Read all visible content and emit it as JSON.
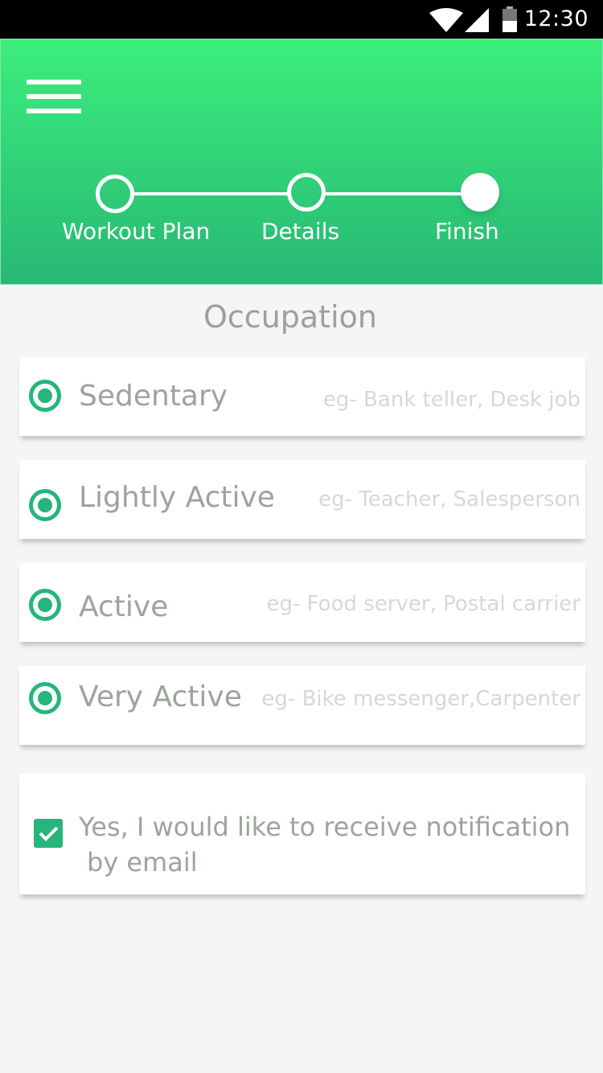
{
  "status_bar": {
    "time": "12:30",
    "icons": [
      "wifi-icon",
      "cellular-signal-icon",
      "battery-icon"
    ]
  },
  "header": {
    "menu_icon": "hamburger-menu-icon",
    "steps": [
      {
        "label": "Workout Plan",
        "state": "completed"
      },
      {
        "label": "Details",
        "state": "completed"
      },
      {
        "label": "Finish",
        "state": "current"
      }
    ]
  },
  "occupation": {
    "title": "Occupation",
    "options": [
      {
        "label": "Sedentary",
        "example": "eg- Bank teller, Desk job"
      },
      {
        "label": "Lightly Active",
        "example": "eg- Teacher, Salesperson"
      },
      {
        "label": "Active",
        "example": "eg- Food server, Postal carrier"
      },
      {
        "label": "Very Active",
        "example": "eg- Bike messenger,Carpenter"
      }
    ]
  },
  "notification": {
    "line1": "Yes, I would like to receive notification",
    "line2": "by email",
    "checked": true
  },
  "colors": {
    "header_top": "#3cee7c",
    "header_bottom": "#27b874",
    "accent": "#26b57a",
    "text": "#9ca49b",
    "hint": "#d6d8d5",
    "background": "#f5f5f5"
  }
}
